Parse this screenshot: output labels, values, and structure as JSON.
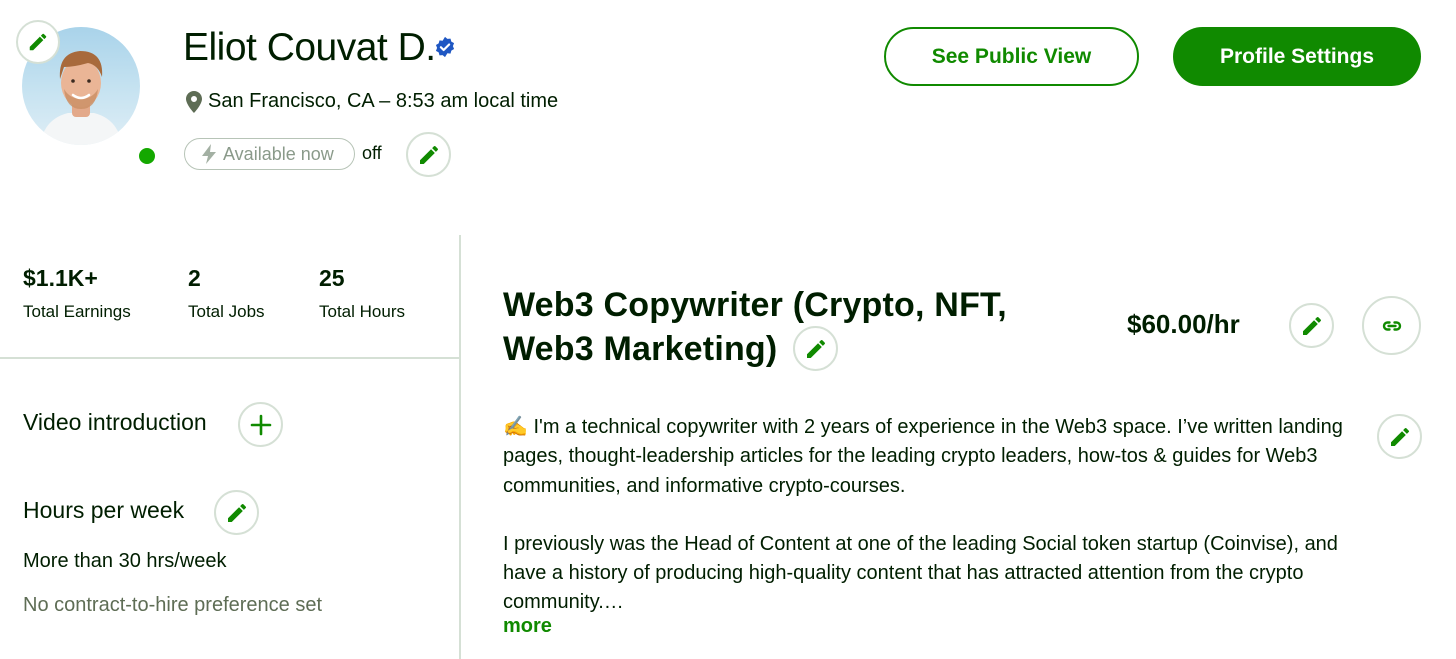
{
  "profile": {
    "name": "Eliot Couvat D.",
    "location": "San Francisco, CA – 8:53 am local time",
    "availability_label": "Available now",
    "availability_state": "off"
  },
  "header_buttons": {
    "public_view": "See Public View",
    "settings": "Profile Settings"
  },
  "stats": [
    {
      "value": "$1.1K+",
      "label": "Total Earnings"
    },
    {
      "value": "2",
      "label": "Total Jobs"
    },
    {
      "value": "25",
      "label": "Total Hours"
    }
  ],
  "sidebar": {
    "video_intro": "Video introduction",
    "hours_title": "Hours per week",
    "hours_value": "More than 30 hrs/week",
    "contract_pref": "No contract-to-hire preference set"
  },
  "main": {
    "title_line1": "Web3 Copywriter (Crypto, NFT,",
    "title_line2": "Web3 Marketing)",
    "rate": "$60.00/hr",
    "overview_p1": "✍️ I'm a technical copywriter with 2 years of experience in the Web3 space. I’ve written landing pages, thought-leadership articles for the leading crypto leaders, how-tos & guides for Web3 communities, and informative crypto-courses.",
    "overview_p2": "I previously was the Head of Content at one of the leading Social token startup (Coinvise), and have a history of producing high-quality content that has attracted attention from the crypto community.…",
    "more_label": "more"
  },
  "colors": {
    "brand_green": "#108a00",
    "online_green": "#14a800",
    "verified_blue": "#1f57c3",
    "muted_text": "#5e6d55"
  },
  "icons": [
    "pencil-icon",
    "verified-badge-icon",
    "location-pin-icon",
    "lightning-icon",
    "plus-icon",
    "link-icon"
  ]
}
